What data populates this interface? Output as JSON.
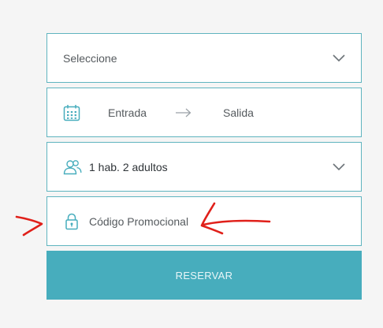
{
  "booking": {
    "hotel_select": {
      "value": "Seleccione"
    },
    "dates": {
      "checkin_label": "Entrada",
      "checkout_label": "Salida"
    },
    "guests": {
      "value": "1 hab. 2 adultos"
    },
    "promo": {
      "placeholder": "Código Promocional"
    },
    "submit_label": "RESERVAR"
  },
  "icons": {
    "dropdown": "chevron-down-icon",
    "calendar": "calendar-icon",
    "arrow": "arrow-right-icon",
    "guests": "users-icon",
    "promo": "lock-icon"
  },
  "colors": {
    "border": "#5fb4bf",
    "accent": "#47adbd",
    "annotation": "#e0201a"
  }
}
